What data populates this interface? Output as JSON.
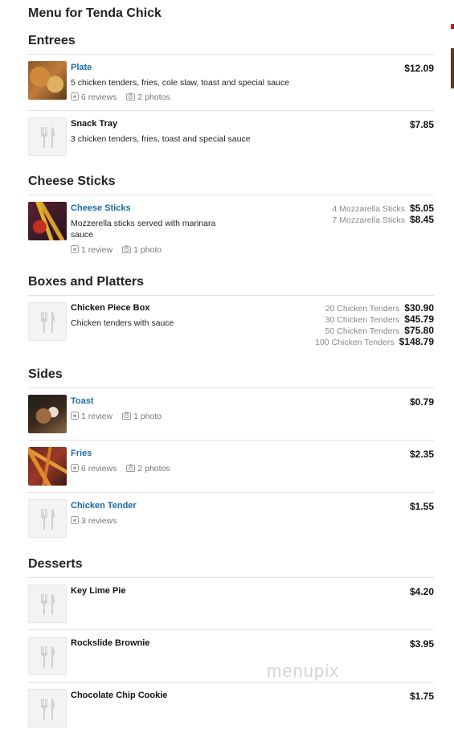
{
  "page": {
    "title": "Menu for Tenda Chick",
    "watermark": "menupix"
  },
  "sections": [
    {
      "title": "Entrees",
      "items": [
        {
          "name": "Plate",
          "desc": "5 chicken tenders, fries, cole slaw, toast and special sauce",
          "price": "$12.09",
          "reviews": "6 reviews",
          "photos": "2 photos",
          "has_photo": true
        },
        {
          "name": "Snack Tray",
          "desc": "3 chicken tenders, fries, toast and special sauce",
          "price": "$7.85",
          "has_photo": false
        }
      ]
    },
    {
      "title": "Cheese Sticks",
      "items": [
        {
          "name": "Cheese Sticks",
          "desc": "Mozzerella sticks served with marinara sauce",
          "reviews": "1 review",
          "photos": "1 photo",
          "has_photo": true,
          "options": [
            {
              "label": "4 Mozzarella Sticks",
              "price": "$5.05"
            },
            {
              "label": "7 Mozzarella Sticks",
              "price": "$8.45"
            }
          ]
        }
      ]
    },
    {
      "title": "Boxes and Platters",
      "items": [
        {
          "name": "Chicken Piece Box",
          "desc": "Chicken tenders with sauce",
          "has_photo": false,
          "options": [
            {
              "label": "20 Chicken Tenders",
              "price": "$30.90"
            },
            {
              "label": "30 Chicken Tenders",
              "price": "$45.79"
            },
            {
              "label": "50 Chicken Tenders",
              "price": "$75.80"
            },
            {
              "label": "100 Chicken Tenders",
              "price": "$148.79"
            }
          ]
        }
      ]
    },
    {
      "title": "Sides",
      "items": [
        {
          "name": "Toast",
          "price": "$0.79",
          "reviews": "1 review",
          "photos": "1 photo",
          "has_photo": true
        },
        {
          "name": "Fries",
          "price": "$2.35",
          "reviews": "6 reviews",
          "photos": "2 photos",
          "has_photo": true
        },
        {
          "name": "Chicken Tender",
          "price": "$1.55",
          "reviews": "3 reviews",
          "has_photo": false
        }
      ]
    },
    {
      "title": "Desserts",
      "items": [
        {
          "name": "Key Lime Pie",
          "price": "$4.20",
          "has_photo": false
        },
        {
          "name": "Rockslide Brownie",
          "price": "$3.95",
          "has_photo": false
        },
        {
          "name": "Chocolate Chip Cookie",
          "price": "$1.75",
          "has_photo": false
        }
      ]
    }
  ],
  "colors": {
    "link": "#1a6aa8",
    "divider": "#e2e2e2",
    "meta": "#777777"
  },
  "icons": {
    "placeholder": "fork-knife-icon",
    "review": "review-icon",
    "photo": "camera-icon"
  }
}
